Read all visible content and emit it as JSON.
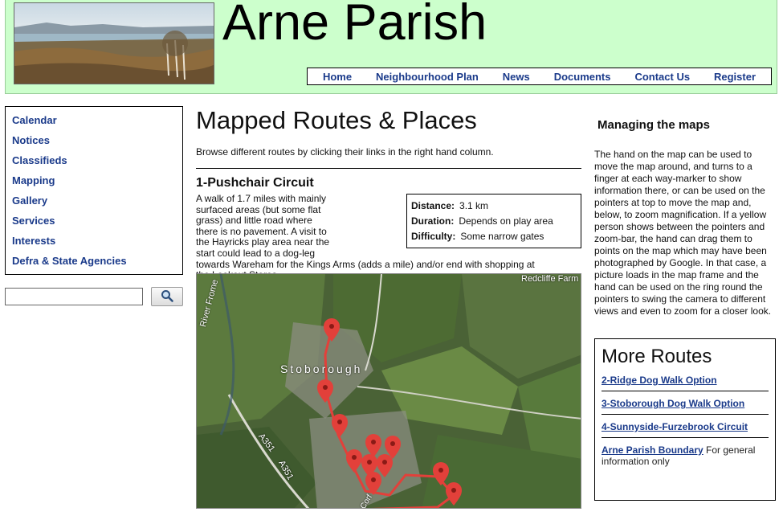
{
  "site": {
    "title": "Arne Parish"
  },
  "nav": [
    {
      "label": "Home"
    },
    {
      "label": "Neighbourhood Plan"
    },
    {
      "label": "News"
    },
    {
      "label": "Documents"
    },
    {
      "label": "Contact Us"
    },
    {
      "label": "Register"
    }
  ],
  "sidebar": [
    {
      "label": "Calendar"
    },
    {
      "label": "Notices"
    },
    {
      "label": "Classifieds"
    },
    {
      "label": "Mapping"
    },
    {
      "label": "Gallery"
    },
    {
      "label": "Services"
    },
    {
      "label": "Interests"
    },
    {
      "label": "Defra & State Agencies"
    }
  ],
  "search": {
    "value": "",
    "icon": "magnifier-icon"
  },
  "main": {
    "title": "Mapped Routes & Places",
    "intro": "Browse different routes by clicking their links in the right hand column.",
    "route_title": "1-Pushchair Circuit",
    "route_desc": "A walk of 1.7 miles with mainly surfaced areas (but some flat grass) and little road where there is no pavement. A visit to the Hayricks play area near the start could lead to a dog-leg towards Wareham for the Kings Arms (adds a mile) and/or end with shopping at the Lookout Stores.",
    "facts": [
      {
        "label": "Distance:",
        "value": "3.1 km"
      },
      {
        "label": "Duration:",
        "value": "Depends on play area"
      },
      {
        "label": "Difficulty:",
        "value": "Some narrow gates"
      }
    ]
  },
  "map": {
    "labels": {
      "farm": "Redcliffe Farm",
      "river": "River Frome",
      "village": "Stoborough",
      "road1": "A351",
      "road2": "A351",
      "road3": "Corf"
    }
  },
  "aside": {
    "title": "Managing the maps",
    "text": "The hand on the map can be used to move the map around, and turns to a finger at each way-marker to show information there, or can be used on the pointers at top to move the map and, below, to zoom magnification. If a yellow person shows between the pointers and zoom-bar, the hand can drag them to points on the map which may have been photographed by Google. In that case, a picture loads in the map frame and the hand can be used on the ring round the pointers to swing the camera to different views and even to zoom for a closer look."
  },
  "more_routes": {
    "title": "More Routes",
    "items": [
      {
        "link": "2-Ridge Dog Walk Option",
        "note": ""
      },
      {
        "link": "3-Stoborough Dog Walk Option",
        "note": ""
      },
      {
        "link": "4-Sunnyside-Furzebrook Circuit",
        "note": ""
      },
      {
        "link": "Arne Parish Boundary",
        "note": " For general information only"
      }
    ]
  },
  "colors": {
    "header_bg": "#ccffcc",
    "link": "#1a3a8a",
    "marker": "#e2403a"
  }
}
